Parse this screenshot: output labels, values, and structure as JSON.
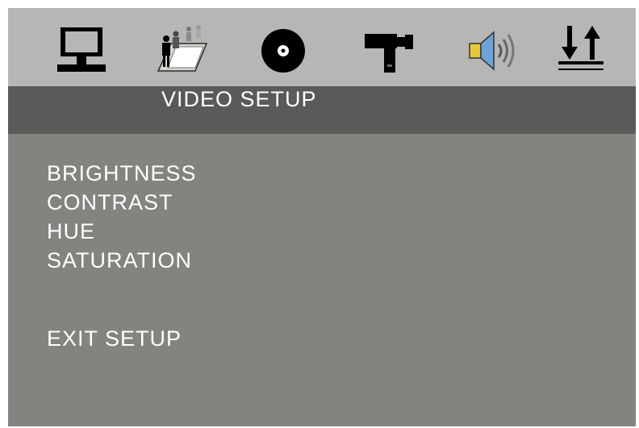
{
  "icons": [
    "general-setup-icon",
    "user-setup-icon",
    "disc-setup-icon",
    "video-setup-icon",
    "audio-setup-icon",
    "preference-setup-icon"
  ],
  "header": {
    "title": "VIDEO SETUP"
  },
  "menu": {
    "items": [
      {
        "label": "BRIGHTNESS"
      },
      {
        "label": "CONTRAST"
      },
      {
        "label": "HUE"
      },
      {
        "label": "SATURATION"
      }
    ],
    "exit_label": "EXIT SETUP"
  },
  "colors": {
    "icon_bar": "#b8b6b4",
    "title_bar": "#5c5a58",
    "body": "#858380",
    "text": "#ffffff"
  }
}
